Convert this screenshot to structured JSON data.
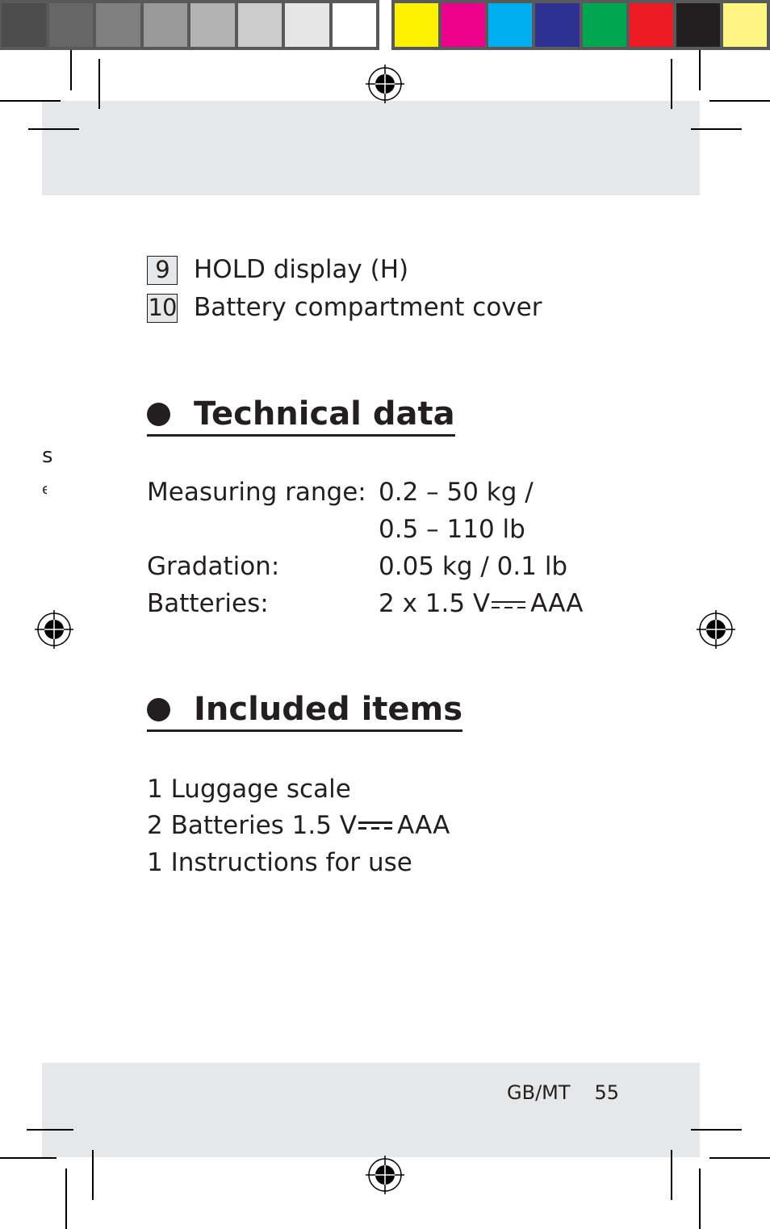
{
  "calibration": {
    "grayscale": [
      "#4d4d4d",
      "#666666",
      "#808080",
      "#999999",
      "#b3b3b3",
      "#cccccc",
      "#e6e6e6",
      "#ffffff"
    ],
    "colors": [
      "#fff200",
      "#ec008c",
      "#00aeef",
      "#2e3192",
      "#00a651",
      "#ed1c24",
      "#231f20",
      "#fff582"
    ]
  },
  "legend": [
    {
      "number": "9",
      "label": "HOLD display (H)"
    },
    {
      "number": "10",
      "label": "Battery compartment cover"
    }
  ],
  "technical_data": {
    "heading": "Technical data",
    "rows": [
      {
        "label": "Measuring range:",
        "value": "0.2 – 50 kg /"
      },
      {
        "label": "",
        "value": "0.5 – 110 lb"
      },
      {
        "label": "Gradation:",
        "value": "0.05 kg / 0.1 lb"
      },
      {
        "label": "Batteries:",
        "value_prefix": "2 x 1.5 V",
        "value_suffix": "AAA"
      }
    ]
  },
  "included_items": {
    "heading": "Included items",
    "items": [
      {
        "text": "1 Luggage scale"
      },
      {
        "text_prefix": "2 Batteries 1.5 V",
        "text_suffix": "AAA"
      },
      {
        "text": "1 Instructions for use"
      }
    ]
  },
  "edge_fragments": [
    "s",
    "e"
  ],
  "footer": {
    "locale": "GB/MT",
    "page_number": "55"
  }
}
